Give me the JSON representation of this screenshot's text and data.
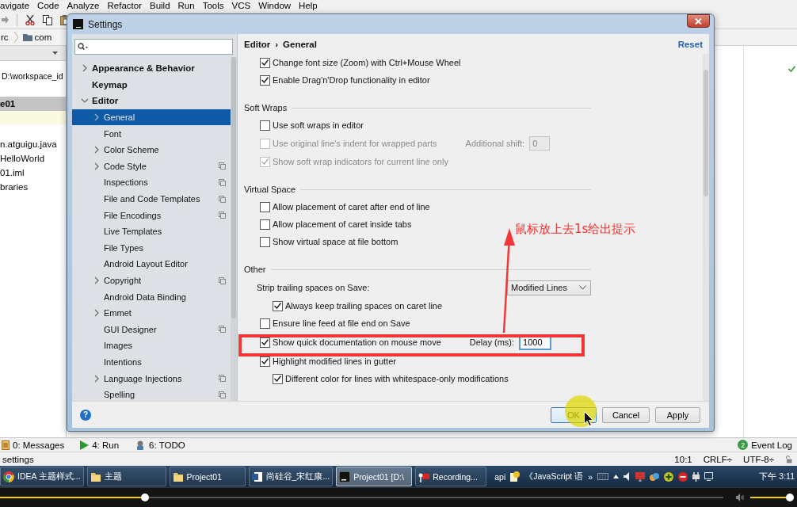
{
  "ide": {
    "menu": [
      "avigate",
      "Code",
      "Analyze",
      "Refactor",
      "Build",
      "Run",
      "Tools",
      "VCS",
      "Window",
      "Help"
    ],
    "breadcrumbs": [
      "rc",
      "com"
    ],
    "project": {
      "path": "D:\\workspace_id",
      "items": [
        {
          "label": "e01",
          "selected": true
        },
        {
          "label": "n.atguigu.java",
          "selected": false
        },
        {
          "label": "HelloWorld",
          "selected": false
        },
        {
          "label": "01.iml",
          "selected": false
        },
        {
          "label": "braries",
          "selected": false
        }
      ]
    },
    "tool_windows": [
      {
        "label": "0: Messages",
        "kind": "messages"
      },
      {
        "label": "4: Run",
        "kind": "run"
      },
      {
        "label": "6: TODO",
        "kind": "todo"
      }
    ],
    "event_log": {
      "label": "Event Log",
      "count": "2"
    },
    "status_bar": {
      "message": "settings",
      "position": "10:1",
      "line_separator": "CRLF÷",
      "encoding": "UTF-8÷"
    }
  },
  "dialog": {
    "title": "Settings",
    "tree": [
      {
        "label": "Appearance & Behavior",
        "expanded": false,
        "selected": false,
        "scoped": false
      },
      {
        "label": "Keymap",
        "selected": false,
        "scoped": false
      },
      {
        "label": "Editor",
        "expanded": true,
        "selected": false,
        "scoped": false,
        "children": [
          {
            "label": "General",
            "expanded": false,
            "selected": true,
            "scoped": false
          },
          {
            "label": "Font",
            "selected": false,
            "scoped": false
          },
          {
            "label": "Color Scheme",
            "expanded": false,
            "selected": false,
            "scoped": false
          },
          {
            "label": "Code Style",
            "expanded": false,
            "selected": false,
            "scoped": true
          },
          {
            "label": "Inspections",
            "selected": false,
            "scoped": true
          },
          {
            "label": "File and Code Templates",
            "selected": false,
            "scoped": true
          },
          {
            "label": "File Encodings",
            "selected": false,
            "scoped": true
          },
          {
            "label": "Live Templates",
            "selected": false,
            "scoped": false
          },
          {
            "label": "File Types",
            "selected": false,
            "scoped": false
          },
          {
            "label": "Android Layout Editor",
            "selected": false,
            "scoped": false
          },
          {
            "label": "Copyright",
            "expanded": false,
            "selected": false,
            "scoped": true
          },
          {
            "label": "Android Data Binding",
            "selected": false,
            "scoped": false
          },
          {
            "label": "Emmet",
            "expanded": false,
            "selected": false,
            "scoped": false
          },
          {
            "label": "GUI Designer",
            "selected": false,
            "scoped": true
          },
          {
            "label": "Images",
            "selected": false,
            "scoped": false
          },
          {
            "label": "Intentions",
            "selected": false,
            "scoped": false
          },
          {
            "label": "Language Injections",
            "expanded": false,
            "selected": false,
            "scoped": true
          },
          {
            "label": "Spelling",
            "selected": false,
            "scoped": true
          }
        ]
      }
    ],
    "breadcrumb": [
      "Editor",
      "General"
    ],
    "breadcrumb_separator": "›",
    "reset": "Reset",
    "sections": [
      {
        "rows": [
          {
            "kind": "checkbox",
            "label": "Change font size (Zoom) with Ctrl+Mouse Wheel",
            "checked": true,
            "disabled": false
          },
          {
            "kind": "checkbox",
            "label": "Enable Drag'n'Drop functionality in editor",
            "checked": true,
            "disabled": false
          }
        ]
      },
      {
        "title": "Soft Wraps",
        "rows": [
          {
            "kind": "checkbox",
            "label": "Use soft wraps in editor",
            "checked": false,
            "disabled": false
          },
          {
            "kind": "checkbox",
            "label": "Use original line's indent for wrapped parts",
            "checked": false,
            "disabled": true,
            "field": {
              "label": "Additional shift:",
              "value": "0",
              "focused": false
            }
          },
          {
            "kind": "checkbox",
            "label": "Show soft wrap indicators for current line only",
            "checked": true,
            "disabled": true
          }
        ]
      },
      {
        "title": "Virtual Space",
        "rows": [
          {
            "kind": "checkbox",
            "label": "Allow placement of caret after end of line",
            "checked": false,
            "disabled": false
          },
          {
            "kind": "checkbox",
            "label": "Allow placement of caret inside tabs",
            "checked": false,
            "disabled": false
          },
          {
            "kind": "checkbox",
            "label": "Show virtual space at file bottom",
            "checked": false,
            "disabled": false
          }
        ]
      },
      {
        "title": "Other",
        "rows": [
          {
            "kind": "dropdown",
            "label": "Strip trailing spaces on Save:",
            "value": "Modified Lines",
            "children": [
              {
                "kind": "checkbox",
                "label": "Always keep trailing spaces on caret line",
                "checked": true,
                "disabled": false
              }
            ]
          },
          {
            "kind": "checkbox",
            "label": "Ensure line feed at file end on Save",
            "checked": false,
            "disabled": false
          },
          {
            "kind": "checkbox",
            "label": "Show quick documentation on mouse move",
            "checked": true,
            "disabled": false,
            "field": {
              "label": "Delay (ms):",
              "value": "1000",
              "focused": true
            }
          },
          {
            "kind": "checkbox",
            "label": "Highlight modified lines in gutter",
            "checked": true,
            "disabled": false,
            "children": [
              {
                "kind": "checkbox",
                "label": "Different color for lines with whitespace-only modifications",
                "checked": true,
                "disabled": false
              }
            ]
          }
        ]
      }
    ],
    "help": "?",
    "buttons": [
      {
        "label": "OK",
        "default": true
      },
      {
        "label": "Cancel",
        "default": false
      },
      {
        "label": "Apply",
        "default": false
      }
    ]
  },
  "annotation": {
    "note": "鼠标放上去1s给出提示"
  },
  "taskbar": {
    "buttons": [
      {
        "label": "IDEA 主题样式...",
        "kind": "browser",
        "selected": false
      },
      {
        "label": "主题",
        "kind": "folder",
        "selected": false
      },
      {
        "label": "Project01",
        "kind": "folder",
        "selected": false
      },
      {
        "label": "尚硅谷_宋红康...",
        "kind": "document",
        "selected": false
      },
      {
        "label": "Project01 [D:\\",
        "kind": "ide",
        "selected": true
      },
      {
        "label": "Recording...",
        "kind": "recorder",
        "selected": false
      }
    ],
    "tray": {
      "input_method": "api",
      "app": "《JavaScript 语",
      "overflow": "»",
      "clock": "下午 3:11"
    }
  },
  "player": {
    "level": 0.2,
    "volume": {
      "level": 1
    }
  }
}
